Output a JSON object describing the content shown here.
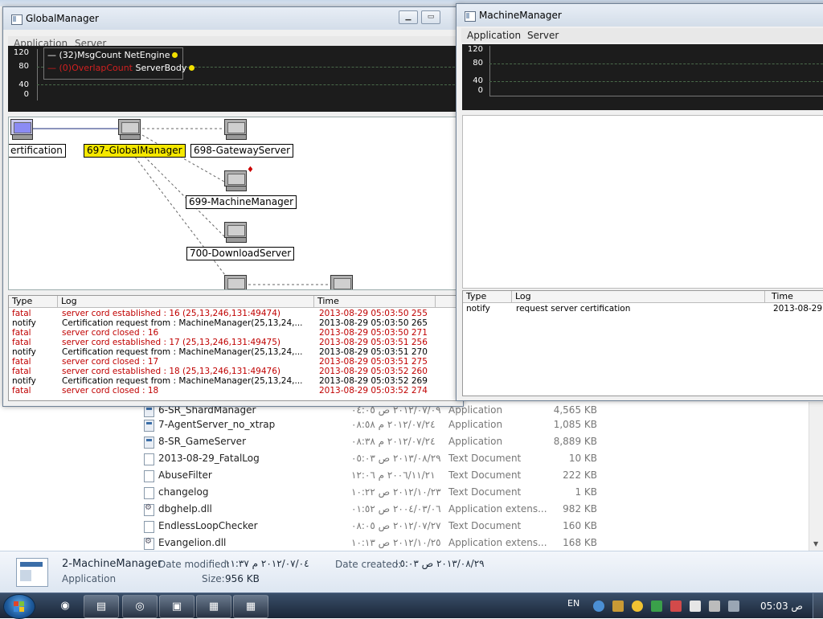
{
  "explorer": {
    "files": [
      {
        "name": "6-SR_ShardManager",
        "date": "٢٠١٢/٠٧/٠٩ ص ٠٤:٠٥",
        "type": "Application",
        "size": "4,565 KB",
        "icon": "app"
      },
      {
        "name": "7-AgentServer_no_xtrap",
        "date": "٢٠١٢/٠٧/٢٤ م ٠٨:٥٨",
        "type": "Application",
        "size": "1,085 KB",
        "icon": "app"
      },
      {
        "name": "8-SR_GameServer",
        "date": "٢٠١٢/٠٧/٢٤ م ٠٨:٣٨",
        "type": "Application",
        "size": "8,889 KB",
        "icon": "app"
      },
      {
        "name": "2013-08-29_FatalLog",
        "date": "٢٠١٣/٠٨/٢٩ ص ٠٥:٠٣",
        "type": "Text Document",
        "size": "10 KB",
        "icon": "doc"
      },
      {
        "name": "AbuseFilter",
        "date": "٢٠٠٦/١١/٢١ م ١٢:٠٦",
        "type": "Text Document",
        "size": "222 KB",
        "icon": "doc"
      },
      {
        "name": "changelog",
        "date": "٢٠١٢/١٠/٢٣ ص ١٠:٢٢",
        "type": "Text Document",
        "size": "1 KB",
        "icon": "doc"
      },
      {
        "name": "dbghelp.dll",
        "date": "٢٠٠٤/٠٣/٠٦ ص ٠١:٥٢",
        "type": "Application extens...",
        "size": "982 KB",
        "icon": "dll"
      },
      {
        "name": "EndlessLoopChecker",
        "date": "٢٠١٢/٠٧/٢٧ ص ٠٨:٠٥",
        "type": "Text Document",
        "size": "160 KB",
        "icon": "doc"
      },
      {
        "name": "Evangelion.dll",
        "date": "٢٠١٢/١٠/٢٥ ص ١٠:١٣",
        "type": "Application extens...",
        "size": "168 KB",
        "icon": "dll"
      }
    ]
  },
  "details": {
    "name": "2-MachineManager",
    "type": "Application",
    "modified_label": "Date modified:",
    "modified_value": "٢٠١٢/٠٧/٠٤ م ١١:٣٧",
    "size_label": "Size:",
    "size_value": "956 KB",
    "created_label": "Date created:",
    "created_value": "٢٠١٣/٠٨/٢٩ ص ٠٥:٠٣"
  },
  "global_manager": {
    "title": "GlobalManager",
    "menu": [
      "Application",
      "Server"
    ],
    "chart_ticks": [
      "120",
      "80",
      "40",
      "0"
    ],
    "legend": [
      {
        "metric": "(32)MsgCount",
        "source": "NetEngine"
      },
      {
        "metric": "(0)OverlapCount",
        "source": "ServerBody"
      }
    ],
    "nodes": [
      "ertification",
      "697-GlobalManager",
      "698-GatewayServer",
      "699-MachineManager",
      "700-DownloadServer"
    ],
    "log_headers": [
      "Type",
      "Log",
      "Time"
    ],
    "logs": [
      {
        "type": "fatal",
        "msg": "server cord established : 16 (25,13,246,131:49474)",
        "time": "2013-08-29 05:03:50 255"
      },
      {
        "type": "notify",
        "msg": "Certification request from : MachineManager(25,13,24,...",
        "time": "2013-08-29 05:03:50 265"
      },
      {
        "type": "fatal",
        "msg": "server cord closed : 16",
        "time": "2013-08-29 05:03:50 271"
      },
      {
        "type": "fatal",
        "msg": "server cord established : 17 (25,13,246,131:49475)",
        "time": "2013-08-29 05:03:51 256"
      },
      {
        "type": "notify",
        "msg": "Certification request from : MachineManager(25,13,24,...",
        "time": "2013-08-29 05:03:51 270"
      },
      {
        "type": "fatal",
        "msg": "server cord closed : 17",
        "time": "2013-08-29 05:03:51 275"
      },
      {
        "type": "fatal",
        "msg": "server cord established : 18 (25,13,246,131:49476)",
        "time": "2013-08-29 05:03:52 260"
      },
      {
        "type": "notify",
        "msg": "Certification request from : MachineManager(25,13,24,...",
        "time": "2013-08-29 05:03:52 269"
      },
      {
        "type": "fatal",
        "msg": "server cord closed : 18",
        "time": "2013-08-29 05:03:52 274"
      }
    ]
  },
  "machine_manager": {
    "title": "MachineManager",
    "menu": [
      "Application",
      "Server"
    ],
    "chart_ticks": [
      "120",
      "80",
      "40",
      "0"
    ],
    "log_headers": [
      "Type",
      "Log",
      "Time"
    ],
    "logs": [
      {
        "type": "notify",
        "msg": "request server certification",
        "time": "2013-08-29"
      }
    ]
  },
  "taskbar": {
    "language": "EN",
    "clock": "05:03 ص"
  },
  "colors": {
    "fatal": "#c00000",
    "selected_node": "#f5e800",
    "legend_dot": "#f2e000",
    "chart_bg": "#1c1c1c"
  }
}
